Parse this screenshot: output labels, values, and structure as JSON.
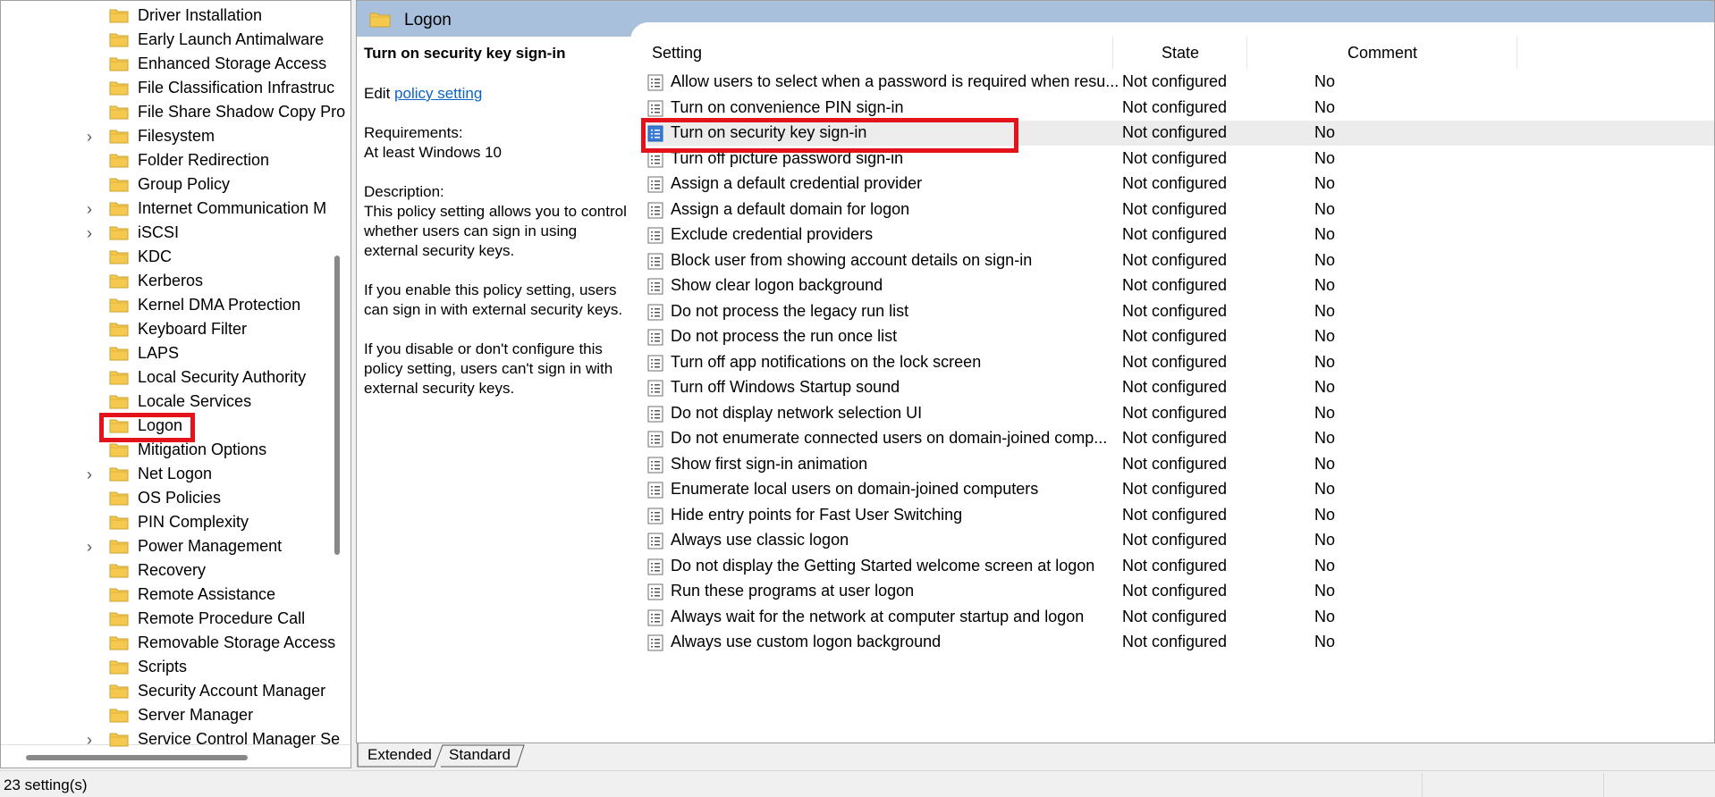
{
  "tree": {
    "items": [
      {
        "label": "Driver Installation",
        "expandable": false
      },
      {
        "label": "Early Launch Antimalware",
        "expandable": false
      },
      {
        "label": "Enhanced Storage Access",
        "expandable": false
      },
      {
        "label": "File Classification Infrastruc",
        "expandable": false
      },
      {
        "label": "File Share Shadow Copy Pro",
        "expandable": false
      },
      {
        "label": "Filesystem",
        "expandable": true
      },
      {
        "label": "Folder Redirection",
        "expandable": false
      },
      {
        "label": "Group Policy",
        "expandable": false
      },
      {
        "label": "Internet Communication M",
        "expandable": true
      },
      {
        "label": "iSCSI",
        "expandable": true
      },
      {
        "label": "KDC",
        "expandable": false
      },
      {
        "label": "Kerberos",
        "expandable": false
      },
      {
        "label": "Kernel DMA Protection",
        "expandable": false
      },
      {
        "label": "Keyboard Filter",
        "expandable": false
      },
      {
        "label": "LAPS",
        "expandable": false
      },
      {
        "label": "Local Security Authority",
        "expandable": false
      },
      {
        "label": "Locale Services",
        "expandable": false
      },
      {
        "label": "Logon",
        "expandable": false,
        "selected": true
      },
      {
        "label": "Mitigation Options",
        "expandable": false
      },
      {
        "label": "Net Logon",
        "expandable": true
      },
      {
        "label": "OS Policies",
        "expandable": false
      },
      {
        "label": "PIN Complexity",
        "expandable": false
      },
      {
        "label": "Power Management",
        "expandable": true
      },
      {
        "label": "Recovery",
        "expandable": false
      },
      {
        "label": "Remote Assistance",
        "expandable": false
      },
      {
        "label": "Remote Procedure Call",
        "expandable": false
      },
      {
        "label": "Removable Storage Access",
        "expandable": false
      },
      {
        "label": "Scripts",
        "expandable": false
      },
      {
        "label": "Security Account Manager",
        "expandable": false
      },
      {
        "label": "Server Manager",
        "expandable": false
      },
      {
        "label": "Service Control Manager Se",
        "expandable": true
      }
    ]
  },
  "header": {
    "title": "Logon"
  },
  "description": {
    "title": "Turn on security key sign-in",
    "edit_prefix": "Edit ",
    "edit_link": "policy setting ",
    "requirements_label": "Requirements:",
    "requirements_value": "At least Windows 10",
    "description_label": "Description:",
    "description_text": "This policy setting allows you to control whether users can sign in using external security keys.",
    "enable_text": "If you enable this policy setting, users can sign in with external security keys.",
    "disable_text": "If you disable or don't configure this policy setting, users can't sign in with external security keys."
  },
  "columns": {
    "setting": "Setting",
    "state": "State",
    "comment": "Comment"
  },
  "settings": [
    {
      "name": "Allow users to select when a password is required when resu...",
      "state": "Not configured",
      "comment": "No"
    },
    {
      "name": "Turn on convenience PIN sign-in",
      "state": "Not configured",
      "comment": "No"
    },
    {
      "name": "Turn on security key sign-in",
      "state": "Not configured",
      "comment": "No",
      "selected": true
    },
    {
      "name": "Turn off picture password sign-in",
      "state": "Not configured",
      "comment": "No"
    },
    {
      "name": "Assign a default credential provider",
      "state": "Not configured",
      "comment": "No"
    },
    {
      "name": "Assign a default domain for logon",
      "state": "Not configured",
      "comment": "No"
    },
    {
      "name": "Exclude credential providers",
      "state": "Not configured",
      "comment": "No"
    },
    {
      "name": "Block user from showing account details on sign-in",
      "state": "Not configured",
      "comment": "No"
    },
    {
      "name": "Show clear logon background",
      "state": "Not configured",
      "comment": "No"
    },
    {
      "name": "Do not process the legacy run list",
      "state": "Not configured",
      "comment": "No"
    },
    {
      "name": "Do not process the run once list",
      "state": "Not configured",
      "comment": "No"
    },
    {
      "name": "Turn off app notifications on the lock screen",
      "state": "Not configured",
      "comment": "No"
    },
    {
      "name": "Turn off Windows Startup sound",
      "state": "Not configured",
      "comment": "No"
    },
    {
      "name": "Do not display network selection UI",
      "state": "Not configured",
      "comment": "No"
    },
    {
      "name": "Do not enumerate connected users on domain-joined comp...",
      "state": "Not configured",
      "comment": "No"
    },
    {
      "name": "Show first sign-in animation",
      "state": "Not configured",
      "comment": "No"
    },
    {
      "name": "Enumerate local users on domain-joined computers",
      "state": "Not configured",
      "comment": "No"
    },
    {
      "name": "Hide entry points for Fast User Switching",
      "state": "Not configured",
      "comment": "No"
    },
    {
      "name": "Always use classic logon",
      "state": "Not configured",
      "comment": "No"
    },
    {
      "name": "Do not display the Getting Started welcome screen at logon",
      "state": "Not configured",
      "comment": "No"
    },
    {
      "name": "Run these programs at user logon",
      "state": "Not configured",
      "comment": "No"
    },
    {
      "name": "Always wait for the network at computer startup and logon",
      "state": "Not configured",
      "comment": "No"
    },
    {
      "name": "Always use custom logon background",
      "state": "Not configured",
      "comment": "No"
    }
  ],
  "tabs": {
    "extended": "Extended",
    "standard": "Standard"
  },
  "status": {
    "text": "23 setting(s)"
  },
  "colors": {
    "header_band": "#a9c0dc",
    "highlight": "#e3121b",
    "link": "#0b63c4",
    "selected_row": "#ececec",
    "folder": "#f5c94e"
  }
}
